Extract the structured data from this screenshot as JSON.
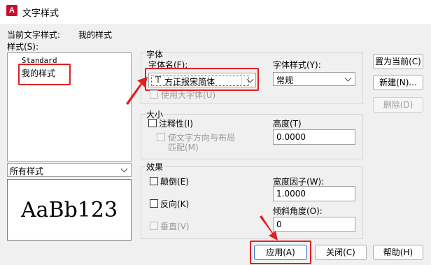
{
  "window": {
    "title": "文字样式",
    "app_icon_letter": "A"
  },
  "current_style": {
    "label": "当前文字样式:",
    "value": "我的样式"
  },
  "styles_list": {
    "label": "样式(S):",
    "items": [
      "Standard",
      "我的样式"
    ]
  },
  "filter_dropdown": {
    "value": "所有样式"
  },
  "preview": {
    "text": "AaBb123"
  },
  "font_group": {
    "title": "字体",
    "font_name_label": "字体名(F):",
    "font_name_value": "方正报宋简体",
    "font_name_glyph": "T",
    "font_style_label": "字体样式(Y):",
    "font_style_value": "常规",
    "big_font_label": "使用大字体(U)"
  },
  "size_group": {
    "title": "大小",
    "annotative_label": "注释性(I)",
    "match_orientation_label_1": "使文字方向与布局",
    "match_orientation_label_2": "匹配(M)",
    "height_label": "高度(T)",
    "height_value": "0.0000"
  },
  "effects_group": {
    "title": "效果",
    "upside_down_label": "颠倒(E)",
    "backwards_label": "反向(K)",
    "vertical_label": "垂直(V)",
    "width_factor_label": "宽度因子(W):",
    "width_factor_value": "1.0000",
    "oblique_label": "倾斜角度(O):",
    "oblique_value": "0"
  },
  "buttons": {
    "set_current": "置为当前(C)",
    "new": "新建(N)...",
    "delete": "删除(D)",
    "apply": "应用(A)",
    "close": "关闭(C)",
    "help": "帮助(H)"
  },
  "colors": {
    "highlight_red": "#e02020",
    "app_icon": "#c8102e"
  }
}
